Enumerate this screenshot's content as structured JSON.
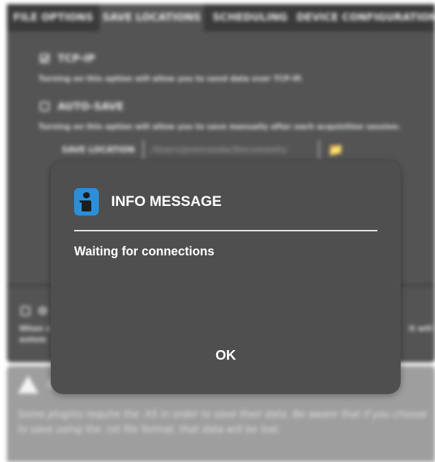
{
  "tabs": [
    {
      "label": "FILE OPTIONS",
      "active": false
    },
    {
      "label": "SAVE LOCATIONS",
      "active": true
    },
    {
      "label": "SCHEDULING",
      "active": false
    },
    {
      "label": "DEVICE CONFIGURATION",
      "active": false
    }
  ],
  "options": {
    "tcpip": {
      "label": "TCP-IP",
      "checked": true,
      "description": "Turning on this option will allow you to send data over TCP-IP."
    },
    "autosave": {
      "label": "AUTO-SAVE",
      "checked": false,
      "description": "Turning on this option will allow you to save manually after each acquisition session."
    },
    "save_location": {
      "label": "SAVE LOCATION",
      "value": "/Users/jomiranda/Documents/"
    },
    "lower_option": {
      "label": "O",
      "checked": false,
      "description_left": "When c",
      "description_left2": "autom",
      "description_right": "it will"
    }
  },
  "warning": {
    "icon": "warning-triangle-icon",
    "text": "Some plugins require the .h5 in order to save their data. Be aware that if you choose to save using the .txt file format, that data will be lost."
  },
  "dialog": {
    "icon": "info-icon",
    "icon_color": "#2a8fd8",
    "title": "INFO MESSAGE",
    "message": "Waiting for connections",
    "ok_label": "OK"
  },
  "colors": {
    "panel": "#545454",
    "tab_inactive": "#3a3a3a",
    "modal": "#4f4f4f",
    "warning_box": "#9e9e9e"
  }
}
